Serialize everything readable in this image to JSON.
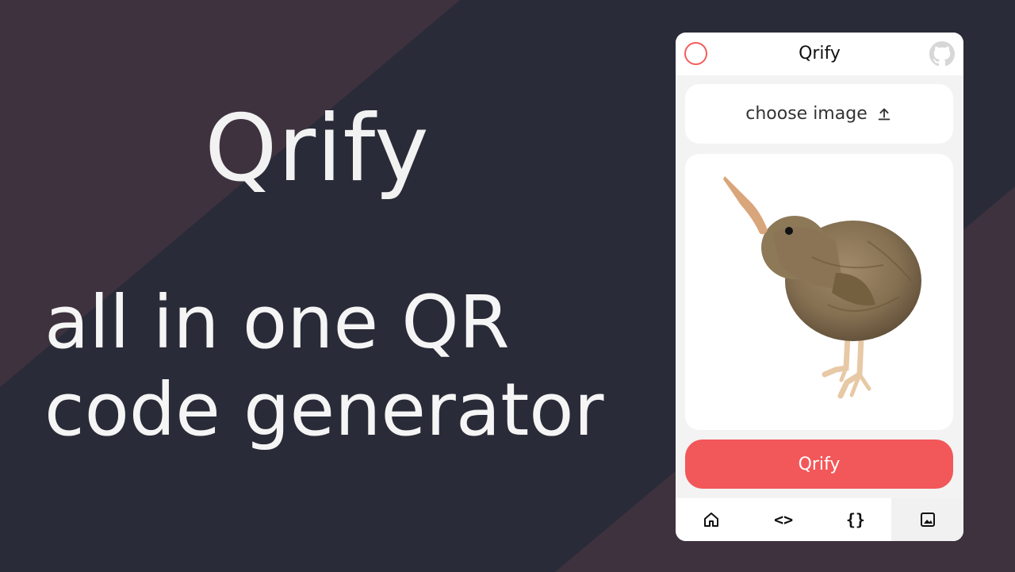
{
  "colors": {
    "background": "#2a2b38",
    "diagonal_band": "#3e323f",
    "accent": "#f25759",
    "text_light": "#f2f2f2"
  },
  "hero": {
    "title": "Qrify",
    "tagline_line1": "all in one QR",
    "tagline_line2": "code generator"
  },
  "app": {
    "title": "Qrify",
    "logo_icon": "red-ring-logo",
    "github_icon": "github-icon",
    "upload": {
      "label": "choose image",
      "icon": "upload-icon"
    },
    "preview_image": "kiwi-bird-illustration",
    "primary_button": "Qrify",
    "nav": [
      {
        "icon": "home-icon",
        "active": false
      },
      {
        "icon": "code-icon",
        "glyph": "<>",
        "active": false
      },
      {
        "icon": "json-braces-icon",
        "glyph": "{}",
        "active": false
      },
      {
        "icon": "image-icon",
        "active": true
      }
    ]
  }
}
